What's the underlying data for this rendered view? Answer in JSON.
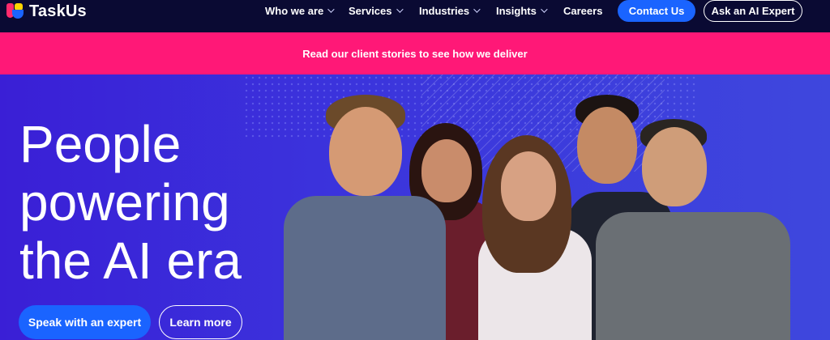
{
  "brand": {
    "name": "TaskUs"
  },
  "nav": {
    "items": [
      {
        "label": "Who we are",
        "has_dropdown": true
      },
      {
        "label": "Services",
        "has_dropdown": true
      },
      {
        "label": "Industries",
        "has_dropdown": true
      },
      {
        "label": "Insights",
        "has_dropdown": true
      },
      {
        "label": "Careers",
        "has_dropdown": false
      }
    ],
    "contact_label": "Contact Us",
    "ask_label": "Ask an AI Expert"
  },
  "banner": {
    "text": "Read our client stories to see how we deliver"
  },
  "hero": {
    "headline": "People\npowering\nthe AI era",
    "primary_cta": "Speak with an expert",
    "secondary_cta": "Learn more"
  },
  "colors": {
    "accent_blue": "#1a64ff",
    "banner_pink": "#ff1877",
    "nav_bg": "#0a0a33",
    "hero_purple": "#3a1fd6"
  },
  "icons": [
    "taskus-logo-icon",
    "chevron-down-icon"
  ]
}
